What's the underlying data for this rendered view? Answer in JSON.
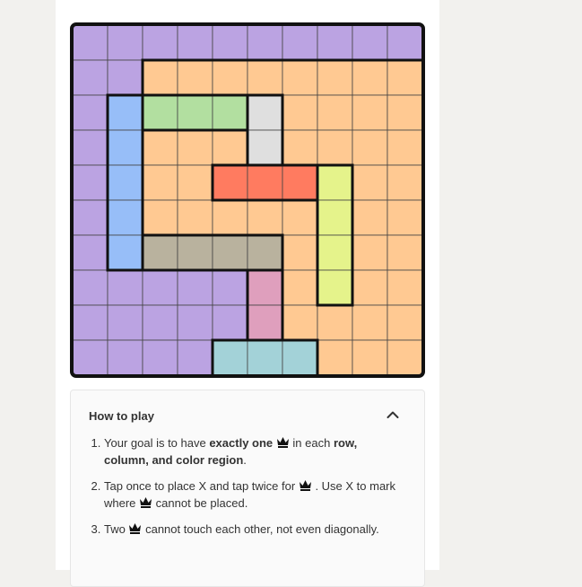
{
  "board": {
    "size": 10,
    "regions": [
      [
        0,
        0,
        0,
        0,
        0,
        0,
        0,
        0,
        0,
        0
      ],
      [
        0,
        0,
        1,
        1,
        1,
        1,
        1,
        1,
        1,
        1
      ],
      [
        0,
        2,
        3,
        3,
        3,
        4,
        1,
        1,
        1,
        1
      ],
      [
        0,
        2,
        1,
        1,
        1,
        4,
        1,
        1,
        1,
        1
      ],
      [
        0,
        2,
        1,
        1,
        5,
        5,
        5,
        6,
        1,
        1
      ],
      [
        0,
        2,
        1,
        1,
        1,
        1,
        1,
        6,
        1,
        1
      ],
      [
        0,
        2,
        7,
        7,
        7,
        7,
        1,
        6,
        1,
        1
      ],
      [
        0,
        0,
        0,
        0,
        0,
        8,
        1,
        6,
        1,
        1
      ],
      [
        0,
        0,
        0,
        0,
        0,
        8,
        1,
        1,
        1,
        1
      ],
      [
        0,
        0,
        0,
        0,
        9,
        9,
        9,
        1,
        1,
        1
      ]
    ],
    "region_colors": [
      "#bba3e2",
      "#ffc992",
      "#97bef8",
      "#b2dfa0",
      "#dfdfdf",
      "#ff7b60",
      "#e5f38b",
      "#b9b29e",
      "#df9fbd",
      "#a3d2d8"
    ]
  },
  "howto": {
    "title": "How to play",
    "rule1": {
      "pre": "Your goal is to have ",
      "bold1": "exactly one",
      "mid": " in each ",
      "bold2": "row, column, and color region",
      "post": "."
    },
    "rule2": {
      "pre": "Tap once to place X and tap twice for",
      "mid": ". Use X to mark where",
      "post": "cannot be placed."
    },
    "rule3": {
      "pre": "Two",
      "post": "cannot touch each other, not even diagonally."
    }
  }
}
